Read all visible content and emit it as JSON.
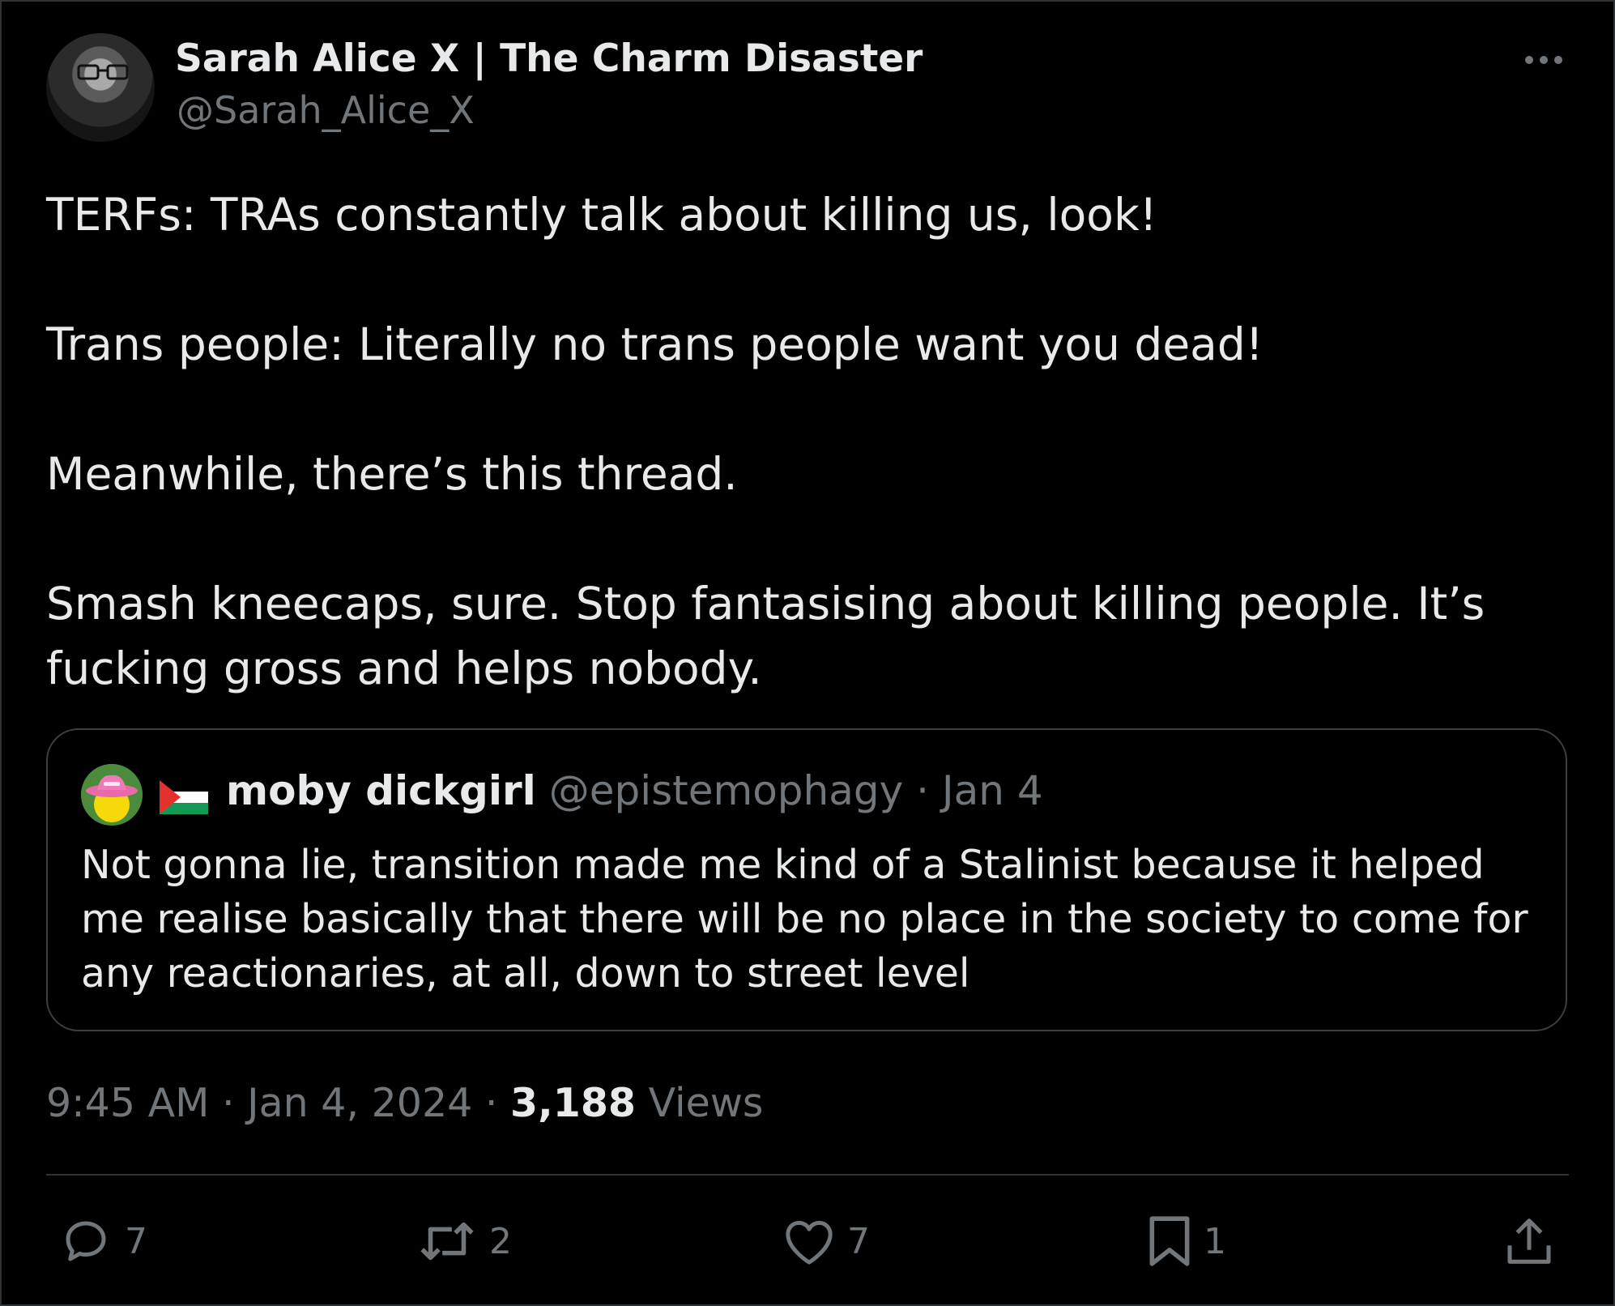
{
  "author": {
    "display_name": "Sarah Alice X | The Charm Disaster",
    "handle": "@Sarah_Alice_X"
  },
  "tweet": {
    "paragraphs": [
      "TERFs: TRAs constantly talk about killing us, look!",
      "Trans people: Literally no trans people want you dead!",
      "Meanwhile, there’s this thread.",
      "Smash kneecaps, sure. Stop fantasising about killing people. It’s fucking gross and helps nobody."
    ]
  },
  "quote": {
    "display_name": "moby dickgirl",
    "handle": "@epistemophagy",
    "separator": "·",
    "date": "Jan 4",
    "text": "Not gonna lie, transition made me kind of a Stalinist because it helped me realise basically that there will be no place in the society to come for any reactionaries, at all, down to street level"
  },
  "meta": {
    "time": "9:45 AM",
    "separator": "·",
    "date": "Jan 4, 2024",
    "views_count": "3,188",
    "views_label": "Views"
  },
  "actions": {
    "reply_count": "7",
    "repost_count": "2",
    "like_count": "7",
    "bookmark_count": "1"
  },
  "colors": {
    "background": "#000000",
    "text": "#e7e9ea",
    "secondary": "#71767b",
    "border": "#2f3336"
  },
  "icons": [
    "more-icon",
    "reply-icon",
    "repost-icon",
    "like-icon",
    "bookmark-icon",
    "share-icon"
  ]
}
